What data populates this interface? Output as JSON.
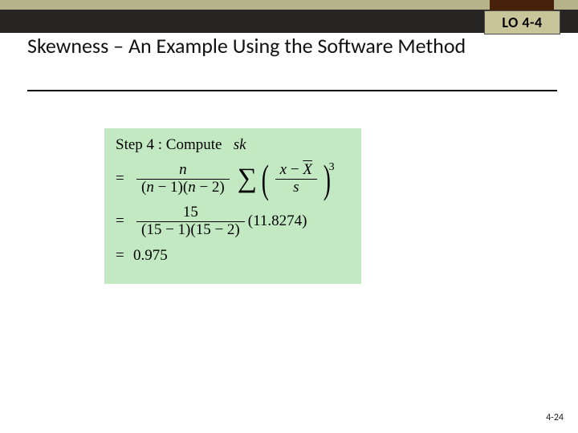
{
  "lo_badge": "LO 4-4",
  "title": "Skewness – An Example Using the Software Method",
  "step_label": "Step 4 : Compute",
  "step_var": "sk",
  "formula": {
    "general": {
      "coef_num": "n",
      "coef_den_left": "n",
      "coef_den_right": "n",
      "minus1": "1",
      "minus2": "2",
      "sum_num_x": "x",
      "sum_num_Xbar": "X",
      "sum_den": "s",
      "power": "3"
    },
    "plugged": {
      "coef_num": "15",
      "coef_den_left": "15",
      "coef_den_right": "15",
      "minus1": "1",
      "minus2": "2",
      "sum_value": "11.8274"
    },
    "result": "0.975"
  },
  "page_number": "4-24"
}
